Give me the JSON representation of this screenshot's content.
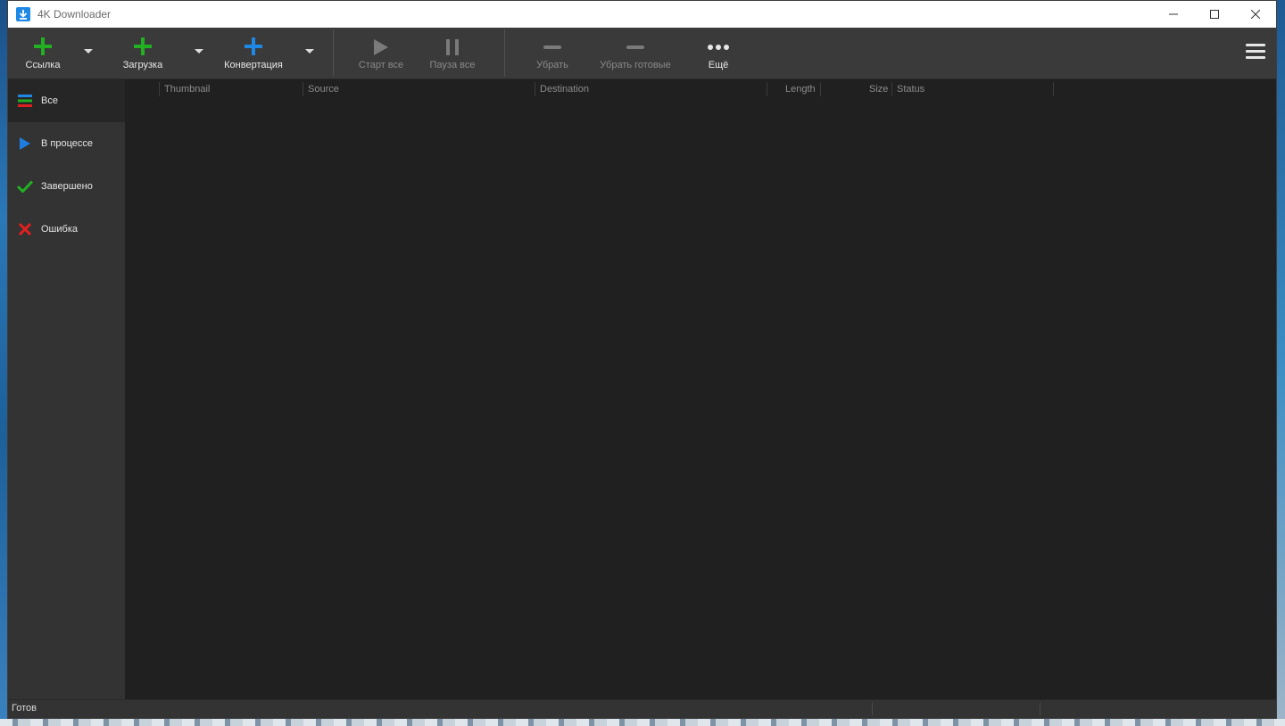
{
  "window": {
    "title": "4K Downloader"
  },
  "toolbar": {
    "link_label": "Ссылка",
    "download_label": "Загрузка",
    "convert_label": "Конвертация",
    "start_all_label": "Старт все",
    "pause_all_label": "Пауза все",
    "remove_label": "Убрать",
    "remove_finished_label": "Убрать готовые",
    "more_label": "Ещё"
  },
  "sidebar": {
    "items": [
      {
        "label": "Все",
        "icon": "all-list-icon"
      },
      {
        "label": "В процессе",
        "icon": "play-icon"
      },
      {
        "label": "Завершено",
        "icon": "check-icon"
      },
      {
        "label": "Ошибка",
        "icon": "error-x-icon"
      }
    ]
  },
  "table": {
    "columns": [
      "Thumbnail",
      "Source",
      "Destination",
      "Length",
      "Size",
      "Status"
    ],
    "rows": []
  },
  "status": {
    "text": "Готов"
  },
  "colors": {
    "green_plus": "#22b022",
    "blue_plus": "#1e88e5",
    "play_blue": "#1e7ee0",
    "check_green": "#22b022",
    "error_red": "#e02020"
  }
}
